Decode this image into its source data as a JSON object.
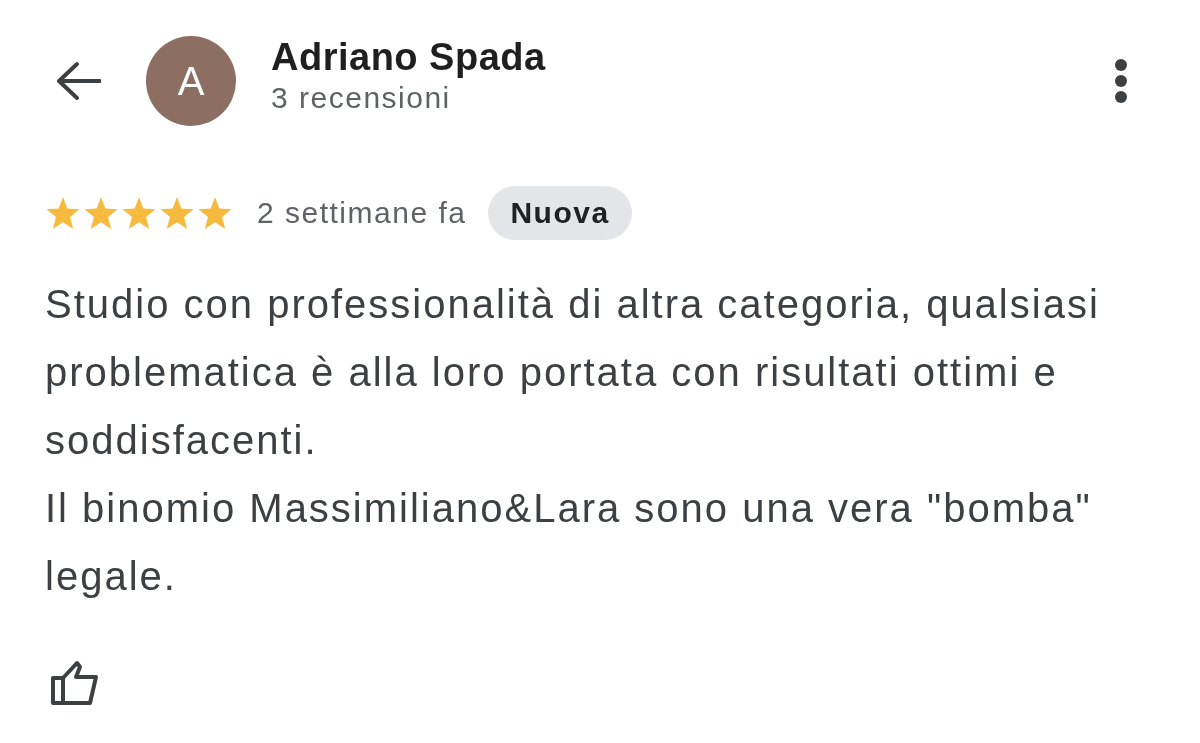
{
  "reviewer": {
    "initial": "A",
    "name": "Adriano Spada",
    "review_count": "3 recensioni"
  },
  "review": {
    "stars": 5,
    "time": "2 settimane fa",
    "badge": "Nuova",
    "paragraphs": [
      "Studio con professionalità di altra categoria, qualsiasi problematica è alla loro portata con risultati ottimi e soddisfacenti.",
      "Il binomio Massimiliano&Lara sono una vera \"bomba\" legale."
    ]
  }
}
